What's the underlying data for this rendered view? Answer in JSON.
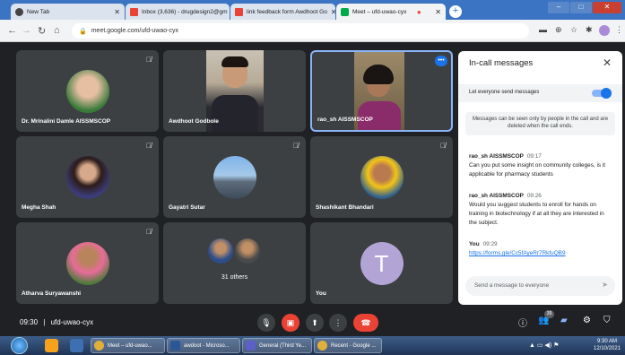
{
  "browser": {
    "tabs": [
      {
        "title": "New Tab",
        "icon": "chrome-icon"
      },
      {
        "title": "Inbox (3,636) - drugdesign2@gm",
        "icon": "gmail-icon"
      },
      {
        "title": "link feedback form Awdhoot Go",
        "icon": "gmail-icon"
      },
      {
        "title": "Meet – ufd-uwao-cyx",
        "icon": "meet-icon",
        "active": true
      }
    ],
    "new_tab": "+",
    "url": "meet.google.com/ufd-uwao-cyx",
    "window_buttons": [
      "–",
      "□",
      "✕"
    ]
  },
  "participants": [
    {
      "name": "Dr. Mrinalini Damle AISSMSCOP",
      "muted": true
    },
    {
      "name": "Awdhoot Godbole",
      "muted": false
    },
    {
      "name": "rao_sh AISSMSCOP",
      "muted": false,
      "speaking": true
    },
    {
      "name": "Megha Shah",
      "muted": true
    },
    {
      "name": "Gayatri Sutar",
      "muted": true
    },
    {
      "name": "Shashikant Bhandari",
      "muted": true
    },
    {
      "name": "Atharva Suryawanshi",
      "muted": true
    },
    {
      "name": "31 others",
      "muted": false
    },
    {
      "name": "You",
      "muted": false,
      "initial": "T"
    }
  ],
  "chat": {
    "title": "In-call messages",
    "close": "✕",
    "toggle_label": "Let everyone send messages",
    "notice": "Messages can be seen only by people in the call and are deleted when the call ends.",
    "messages": [
      {
        "sender": "rao_sh AISSMSCOP",
        "time": "09:17",
        "text": "Can you put some insight on community colleges, is it applicable for pharmacy students"
      },
      {
        "sender": "rao_sh AISSMSCOP",
        "time": "09:26",
        "text": "Would you suggest students to enroll for hands on training in biotechnology if at all they are interested in the subject."
      },
      {
        "sender": "You",
        "time": "09:29",
        "link": "https://forms.gle/Cc5fAyeRr7RkfuQB9"
      }
    ],
    "compose_placeholder": "Send a message to everyone"
  },
  "bottom_bar": {
    "time": "09:30",
    "separator": "|",
    "meeting_code": "ufd-uwao-cyx",
    "participant_count": "39"
  },
  "taskbar": {
    "buttons": [
      {
        "label": "Meet – ufd-uwao...",
        "color": "#e0b03a"
      },
      {
        "label": "awdoot - Microso...",
        "color": "#2b5797"
      },
      {
        "label": "General (Third Ye...",
        "color": "#5b5fc7"
      },
      {
        "label": "Recent - Google ...",
        "color": "#e0b03a"
      }
    ],
    "clock_time": "9:30 AM",
    "clock_date": "12/10/2021"
  },
  "colors": {
    "meet_bg": "#202124",
    "tile_bg": "#3c4043",
    "accent": "#1a73e8",
    "end_call": "#ea4335"
  }
}
